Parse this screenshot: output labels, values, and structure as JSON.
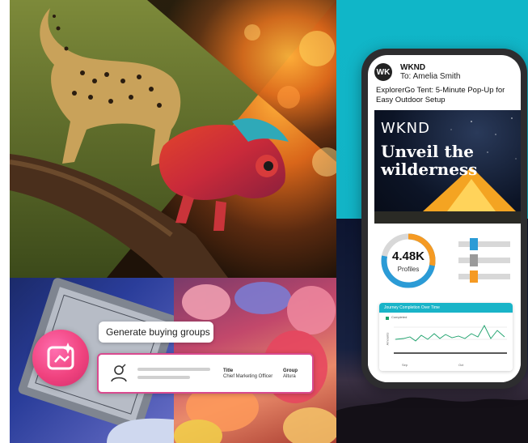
{
  "phone": {
    "avatar_initials": "WK",
    "sender": "WKND",
    "recipient": "To: Amelia Smith",
    "subject": "ExplorerGo Tent: 5-Minute Pop-Up for Easy Outdoor Setup",
    "banner": {
      "brand": "WKND",
      "headline": "Unveil the wilderness"
    },
    "dashboard": {
      "profiles_value": "4.48K",
      "profiles_label": "Profiles",
      "profiles_progress_fraction": 0.78,
      "sliders": [
        {
          "knob_color": "#2b9bd6",
          "level_fraction": 0.3
        },
        {
          "knob_color": "#9a9a9a",
          "level_fraction": 0.3
        },
        {
          "knob_color": "#f59a23",
          "level_fraction": 0.3
        }
      ],
      "journey_chart": {
        "title": "Journey Completion Over Time",
        "legend": "Completed",
        "ylabel": "Amounts",
        "xticks": [
          "Sep",
          "Oct"
        ],
        "series_color": "#1aa06a"
      }
    }
  },
  "buying_group": {
    "prompt_label": "Generate buying groups",
    "card": {
      "title_label": "Title",
      "title_value": "Chief Marketing Officer",
      "group_label": "Group",
      "group_value": "Altura"
    }
  },
  "colors": {
    "teal": "#12b4c6",
    "accent_pink": "#f0437f",
    "donut_orange": "#f59a23",
    "donut_blue": "#2b9bd6"
  }
}
